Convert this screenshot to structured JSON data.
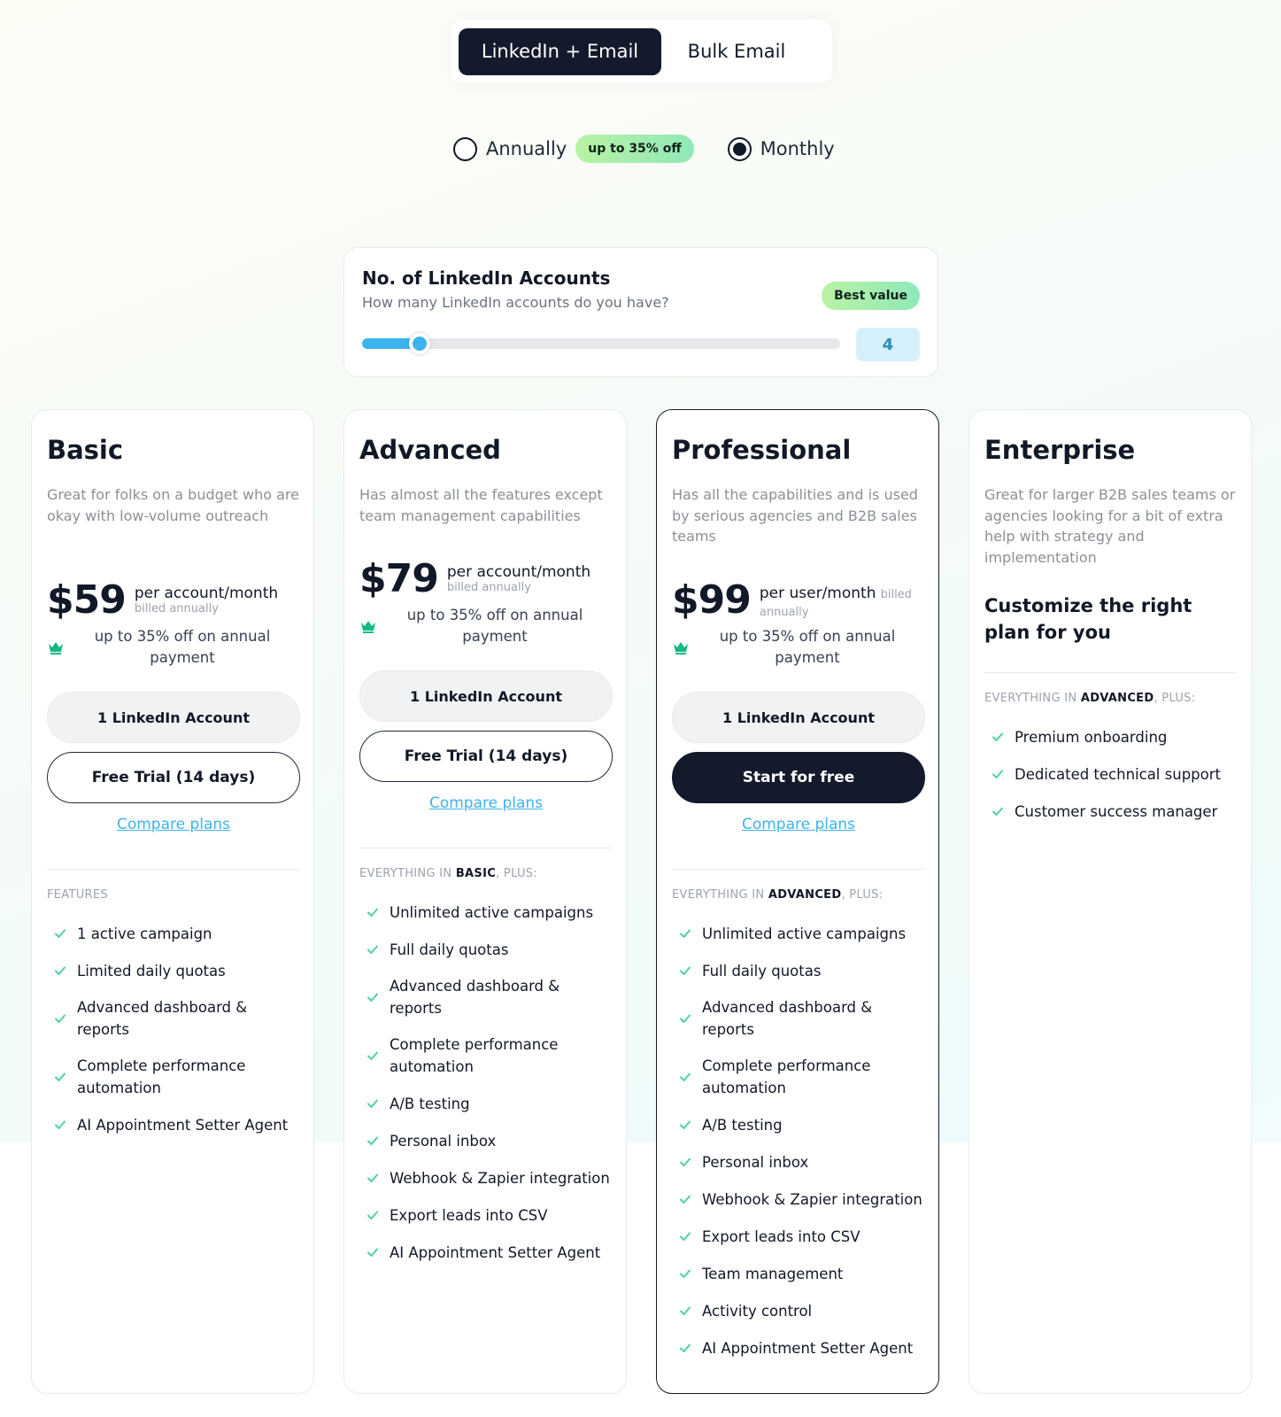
{
  "product_tabs": {
    "active": "LinkedIn + Email",
    "inactive": "Bulk Email"
  },
  "billing": {
    "annually_label": "Annually",
    "discount_badge": "up to 35% off",
    "monthly_label": "Monthly",
    "selected": "Monthly"
  },
  "accounts_selector": {
    "title": "No. of LinkedIn Accounts",
    "subtitle": "How many LinkedIn accounts do you have?",
    "badge": "Best value",
    "value": "4",
    "slider_fraction": 0.11
  },
  "colors": {
    "dark": "#131a2c",
    "accent": "#3cb3ec",
    "check": "#4fd1a5",
    "crown": "#10b981"
  },
  "plans": [
    {
      "name": "Basic",
      "description": "Great for folks on a budget who are okay with low-volume outreach",
      "price": "$59",
      "price_unit": "per account/month",
      "price_billed": "billed annually",
      "discount_text": "up to 35% off on annual payment",
      "accounts_button": "1 LinkedIn Account",
      "cta": "Free Trial (14 days)",
      "compare": "Compare plans",
      "section_prefix": "FEATURES",
      "section_plan": "",
      "section_suffix": "",
      "features": [
        "1 active campaign",
        "Limited daily quotas",
        "Advanced dashboard & reports",
        "Complete performance automation",
        "AI Appointment Setter Agent"
      ]
    },
    {
      "name": "Advanced",
      "description": "Has almost all the features except team management capabilities",
      "price": "$79",
      "price_unit": "per account/month",
      "price_billed": "billed annually",
      "discount_text": "up to 35% off on annual payment",
      "accounts_button": "1 LinkedIn Account",
      "cta": "Free Trial (14 days)",
      "compare": "Compare plans",
      "section_prefix": "EVERYTHING IN ",
      "section_plan": "BASIC",
      "section_suffix": ", PLUS:",
      "features": [
        "Unlimited active campaigns",
        "Full daily quotas",
        "Advanced dashboard & reports",
        "Complete performance automation",
        "A/B testing",
        "Personal inbox",
        "Webhook & Zapier integration",
        "Export leads into CSV",
        "AI Appointment Setter Agent"
      ]
    },
    {
      "name": "Professional",
      "description": "Has all the capabilities and is used by serious agencies and B2B sales teams",
      "price": "$99",
      "price_unit": "per user/month",
      "price_billed": "billed annually",
      "discount_text": "up to 35% off on annual payment",
      "accounts_button": "1 LinkedIn Account",
      "cta": "Start for free",
      "compare": "Compare plans",
      "section_prefix": "EVERYTHING IN ",
      "section_plan": "ADVANCED",
      "section_suffix": ", PLUS:",
      "features": [
        "Unlimited active campaigns",
        "Full daily quotas",
        "Advanced dashboard & reports",
        "Complete performance automation",
        "A/B testing",
        "Personal inbox",
        "Webhook & Zapier integration",
        "Export leads into CSV",
        "Team management",
        "Activity control",
        "AI Appointment Setter Agent"
      ]
    },
    {
      "name": "Enterprise",
      "description": "Great for larger B2B sales teams or agencies looking for a bit of extra help with strategy and implementation",
      "tagline": "Customize the right plan for you",
      "section_prefix": "EVERYTHING IN ",
      "section_plan": "ADVANCED",
      "section_suffix": ", PLUS:",
      "features": [
        "Premium onboarding",
        "Dedicated technical support",
        "Customer success manager"
      ]
    }
  ]
}
